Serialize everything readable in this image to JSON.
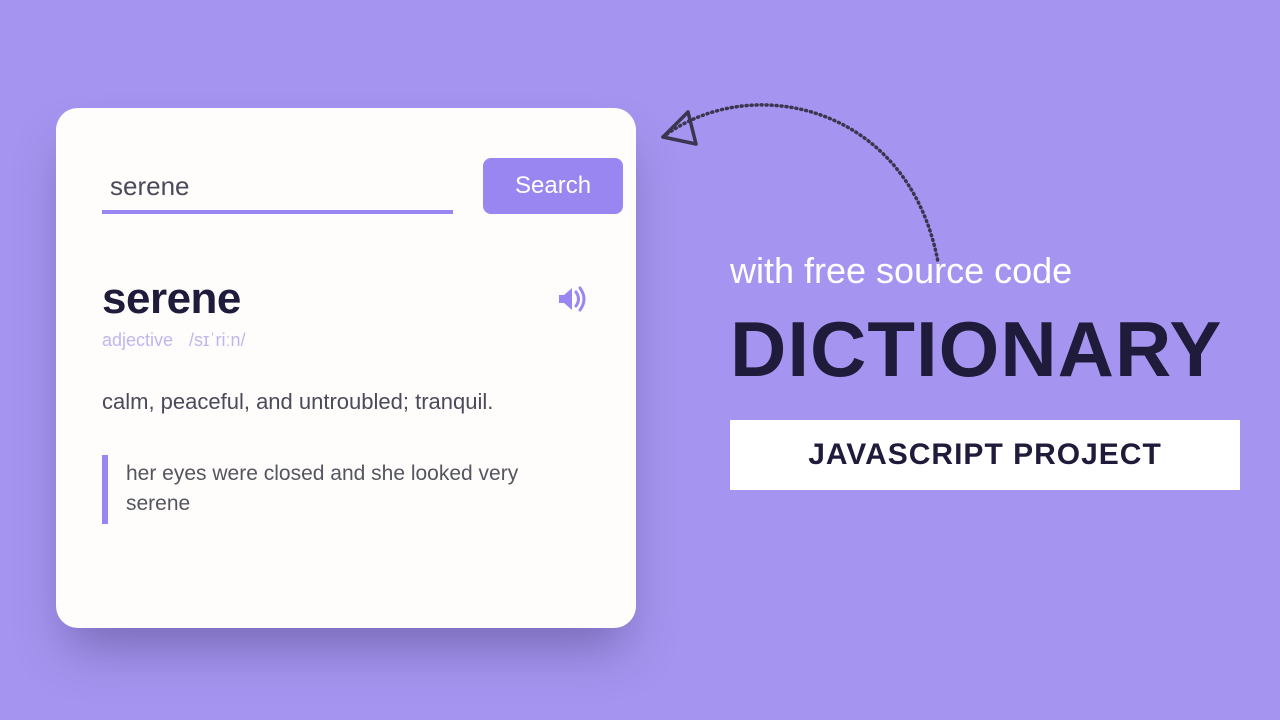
{
  "search": {
    "value": "serene",
    "button_label": "Search"
  },
  "result": {
    "word": "serene",
    "part_of_speech": "adjective",
    "pronunciation": "/sɪˈriːn/",
    "definition": "calm, peaceful, and untroubled; tranquil.",
    "example": "her eyes were closed and she looked very serene"
  },
  "hero": {
    "subtitle": "with free source code",
    "title": "DICTIONARY",
    "badge": "JAVASCRIPT PROJECT"
  }
}
